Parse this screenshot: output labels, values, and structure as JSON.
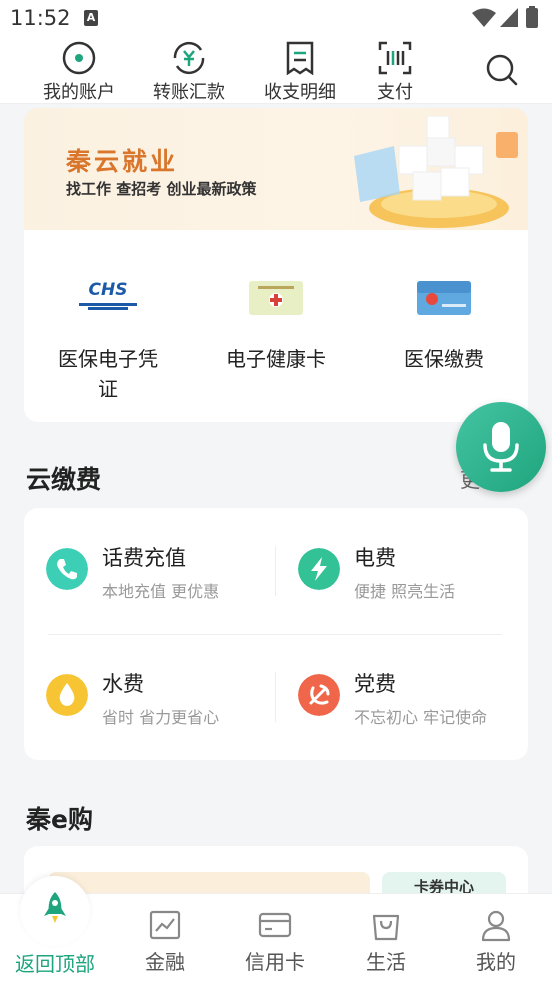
{
  "status_bar": {
    "time": "11:52",
    "sim_label": "A"
  },
  "top_nav": [
    {
      "label": "我的账户",
      "icon": "account-icon"
    },
    {
      "label": "转账汇款",
      "icon": "transfer-icon"
    },
    {
      "label": "收支明细",
      "icon": "statement-icon"
    },
    {
      "label": "支付",
      "icon": "scan-pay-icon"
    }
  ],
  "banner": {
    "title": "秦云就业",
    "subtitle": "找工作 查招考 创业最新政策"
  },
  "services": [
    {
      "label": "医保电子凭证",
      "icon": "chs-logo-icon",
      "logo_text": "CHS"
    },
    {
      "label": "电子健康卡",
      "icon": "health-card-icon"
    },
    {
      "label": "医保缴费",
      "icon": "insurance-card-icon"
    }
  ],
  "cloud_pay": {
    "title": "云缴费",
    "more_label": "更",
    "items": [
      {
        "name": "话费充值",
        "desc": "本地充值 更优惠",
        "icon": "phone-icon",
        "color": "#3ccfb6"
      },
      {
        "name": "电费",
        "desc": "便捷 照亮生活",
        "icon": "lightning-icon",
        "color": "#33c296"
      },
      {
        "name": "水费",
        "desc": "省时 省力更省心",
        "icon": "water-drop-icon",
        "color": "#f7c533"
      },
      {
        "name": "党费",
        "desc": "不忘初心 牢记使命",
        "icon": "party-emblem-icon",
        "color": "#f0664a"
      }
    ]
  },
  "qin_e_shop": {
    "title": "秦e购",
    "coupon_label": "卡券中心"
  },
  "bottom_nav": [
    {
      "label": "返回顶部",
      "icon": "rocket-icon",
      "active": true
    },
    {
      "label": "金融",
      "icon": "chart-icon"
    },
    {
      "label": "信用卡",
      "icon": "credit-card-icon"
    },
    {
      "label": "生活",
      "icon": "shopping-bag-icon"
    },
    {
      "label": "我的",
      "icon": "user-icon"
    }
  ],
  "colors": {
    "accent": "#1ea57e",
    "banner_title": "#d9762b"
  }
}
